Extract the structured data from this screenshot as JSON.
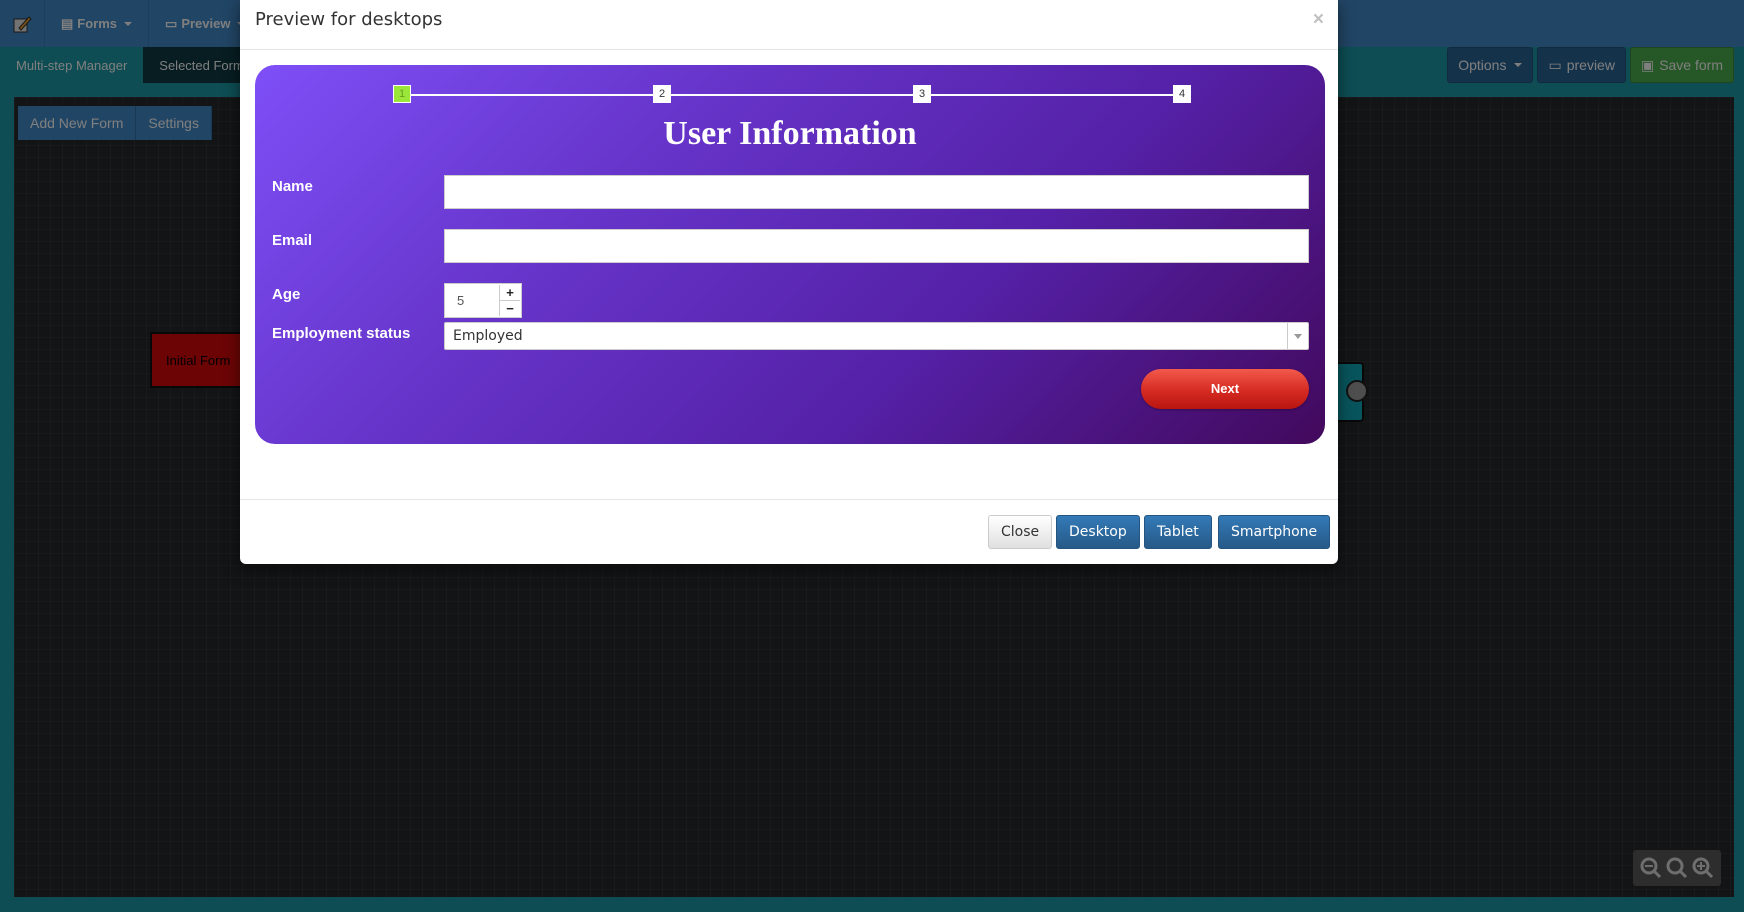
{
  "app": {
    "menus": [
      {
        "label": "Forms",
        "icon": "file-icon"
      },
      {
        "label": "Preview",
        "icon": "monitor-icon"
      }
    ],
    "subtabs": [
      {
        "label": "Multi-step Manager"
      },
      {
        "label": "Selected Form"
      }
    ],
    "tools": {
      "options_label": "Options",
      "preview_label": "preview",
      "save_label": "Save form"
    },
    "canvas_buttons": {
      "add_label": "Add New Form",
      "settings_label": "Settings"
    },
    "nodes": {
      "initial_label": "Initial Form"
    }
  },
  "modal": {
    "title": "Preview for desktops",
    "close_glyph": "×",
    "form": {
      "steps": [
        "1",
        "2",
        "3",
        "4"
      ],
      "active_step": 1,
      "title": "User Information",
      "fields": {
        "name_label": "Name",
        "name_value": "",
        "email_label": "Email",
        "email_value": "",
        "age_label": "Age",
        "age_value": "5",
        "employment_label": "Employment status",
        "employment_value": "Employed"
      },
      "next_label": "Next"
    },
    "footer": {
      "close_label": "Close",
      "desktop_label": "Desktop",
      "tablet_label": "Tablet",
      "smartphone_label": "Smartphone"
    }
  },
  "colors": {
    "app_blue": "#428bca",
    "teal": "#1a9aa6",
    "form_gradient_start": "#7e4ff7",
    "form_gradient_end": "#42095c",
    "next_button": "#d52a21",
    "active_step": "#9ae639"
  }
}
